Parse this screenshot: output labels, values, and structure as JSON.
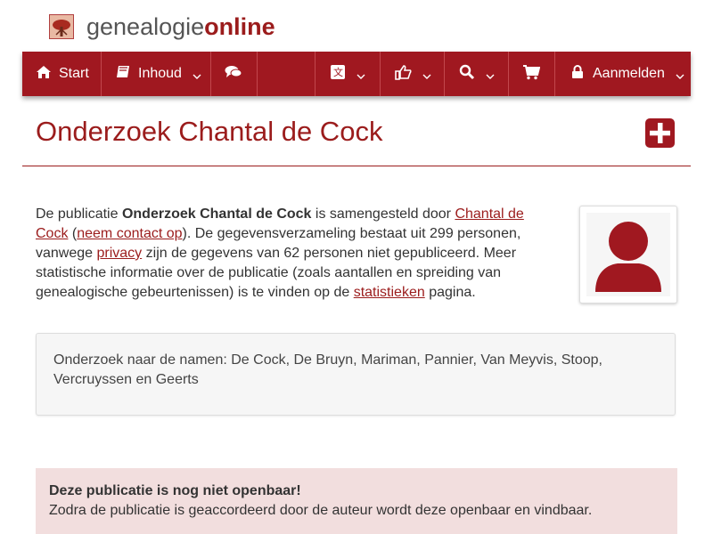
{
  "logo": {
    "text_plain": "genealogie",
    "text_bold": "online",
    "icon": "tree-logo-icon"
  },
  "nav": {
    "start": "Start",
    "inhoud": "Inhoud",
    "chat_icon": "comments-icon",
    "language_icon": "language-icon",
    "like_icon": "thumbs-up-icon",
    "search_icon": "search-icon",
    "cart_icon": "cart-icon",
    "login": "Aanmelden"
  },
  "page": {
    "title": "Onderzoek Chantal de Cock",
    "add_icon": "plus-square-icon"
  },
  "intro": {
    "p1": "De publicatie ",
    "pub_name": "Onderzoek Chantal de Cock",
    "p2": " is samengesteld door ",
    "author_link": "Chantal de Cock",
    "p3": " (",
    "contact_link": "neem contact op",
    "p4": "). De gegevensverzameling bestaat uit 299 personen, vanwege ",
    "privacy_link": "privacy",
    "p5": " zijn de gegevens van 62 personen niet gepubliceerd. Meer statistische informatie over de publicatie (zoals aantallen en spreiding van genealogische gebeurtenissen) is te vinden op de ",
    "stats_link": "statistieken",
    "p6": " pagina."
  },
  "names_box": "Onderzoek naar de namen: De Cock, De Bruyn, Mariman, Pannier, Van Meyvis, Stoop, Vercruyssen en Geerts",
  "alert": {
    "title": "Deze publicatie is nog niet openbaar!",
    "body": "Zodra de publicatie is geaccordeerd door de auteur wordt deze openbaar en vindbaar."
  },
  "colors": {
    "brand": "#a01820",
    "alert_bg": "#f2dede"
  }
}
